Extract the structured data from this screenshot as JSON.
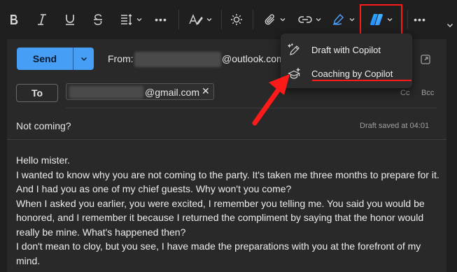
{
  "toolbar": {
    "items": [
      "bold-icon",
      "italic-icon",
      "underline-icon",
      "strikethrough-icon",
      "line-spacing-icon",
      "more-format-icon",
      "styles-icon",
      "theme-icon",
      "attach-icon",
      "link-icon",
      "signature-icon",
      "copilot-icon",
      "more-options-icon"
    ],
    "more_label": "•••",
    "accent_color": "#479ef5",
    "highlight_color": "#ff1a1a"
  },
  "compose": {
    "send_label": "Send",
    "from_label": "From:",
    "from_domain": "@outlook.com",
    "to_label": "To",
    "recipient_domain": "@gmail.com",
    "remove_recipient": "✕",
    "cc_label": "Cc",
    "bcc_label": "Bcc",
    "subject": "Not coming?",
    "draft_status": "Draft saved at 04:01",
    "body_lines": [
      "Hello mister.",
      "I wanted to know why you are not coming to the party. It's taken me three months to prepare for it. And I had you as one of my chief guests. Why won't you come?",
      "When I asked you earlier, you were excited, I remember you telling me. You said you would be honored, and I remember it because I returned the compliment by saying that the honor would really be mine. What's happened then?",
      "I don't mean to cloy, but you see, I have made the preparations with you at the forefront of my mind."
    ]
  },
  "copilot_menu": {
    "items": [
      {
        "label": "Draft with Copilot",
        "icon": "draft-pen-icon"
      },
      {
        "label": "Coaching by Copilot",
        "icon": "coaching-cap-icon"
      }
    ]
  }
}
